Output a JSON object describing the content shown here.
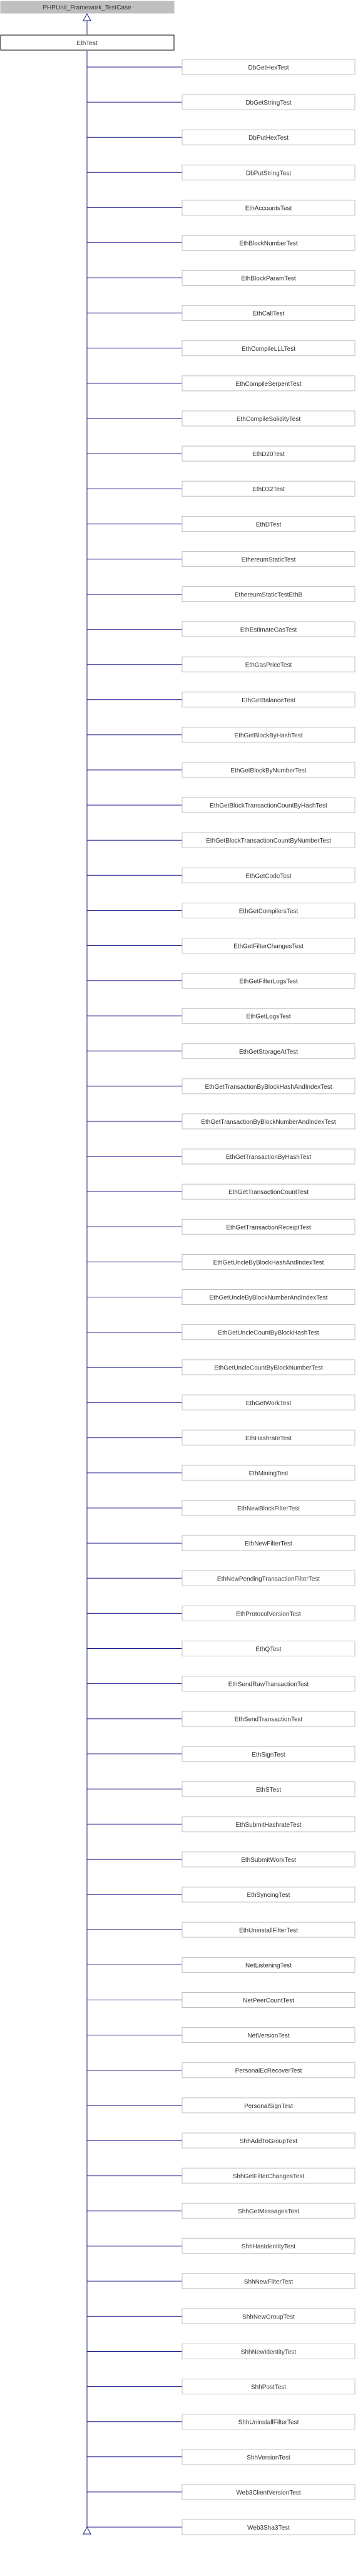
{
  "diagram": {
    "type": "class-hierarchy",
    "root": {
      "label": "PHPUnit_Framework_TestCase"
    },
    "base": {
      "label": "EthTest"
    },
    "children": [
      "DbGetHexTest",
      "DbGetStringTest",
      "DbPutHexTest",
      "DbPutStringTest",
      "EthAccountsTest",
      "EthBlockNumberTest",
      "EthBlockParamTest",
      "EthCallTest",
      "EthCompileLLLTest",
      "EthCompileSerpentTest",
      "EthCompileSolidityTest",
      "EthD20Test",
      "EthD32Test",
      "EthDTest",
      "EthereumStaticTest",
      "EthereumStaticTestEthB",
      "EthEstimateGasTest",
      "EthGasPriceTest",
      "EthGetBalanceTest",
      "EthGetBlockByHashTest",
      "EthGetBlockByNumberTest",
      "EthGetBlockTransactionCountByHashTest",
      "EthGetBlockTransactionCountByNumberTest",
      "EthGetCodeTest",
      "EthGetCompilersTest",
      "EthGetFilterChangesTest",
      "EthGetFilterLogsTest",
      "EthGetLogsTest",
      "EthGetStorageAtTest",
      "EthGetTransactionByBlockHashAndIndexTest",
      "EthGetTransactionByBlockNumberAndIndexTest",
      "EthGetTransactionByHashTest",
      "EthGetTransactionCountTest",
      "EthGetTransactionReceiptTest",
      "EthGetUncleByBlockHashAndIndexTest",
      "EthGetUncleByBlockNumberAndIndexTest",
      "EthGetUncleCountByBlockHashTest",
      "EthGetUncleCountByBlockNumberTest",
      "EthGetWorkTest",
      "EthHashrateTest",
      "EthMiningTest",
      "EthNewBlockFilterTest",
      "EthNewFilterTest",
      "EthNewPendingTransactionFilterTest",
      "EthProtocolVersionTest",
      "EthQTest",
      "EthSendRawTransactionTest",
      "EthSendTransactionTest",
      "EthSignTest",
      "EthSTest",
      "EthSubmitHashrateTest",
      "EthSubmitWorkTest",
      "EthSyncingTest",
      "EthUninstallFilterTest",
      "NetListeningTest",
      "NetPeerCountTest",
      "NetVersionTest",
      "PersonalEcRecoverTest",
      "PersonalSignTest",
      "ShhAddToGroupTest",
      "ShhGetFilterChangesTest",
      "ShhGetMessagesTest",
      "ShhHasIdentityTest",
      "ShhNewFilterTest",
      "ShhNewGroupTest",
      "ShhNewIdentityTest",
      "ShhPostTest",
      "ShhUninstallFilterTest",
      "ShhVersionTest",
      "Web3ClientVersionTest",
      "Web3Sha3Test"
    ],
    "colors": {
      "root_fill": "#bfbfbf",
      "node_fill": "#ffffff",
      "node_border": "#bfbfbf",
      "base_border": "#000000",
      "edge": "#1a1a8c",
      "text": "#333333"
    }
  }
}
